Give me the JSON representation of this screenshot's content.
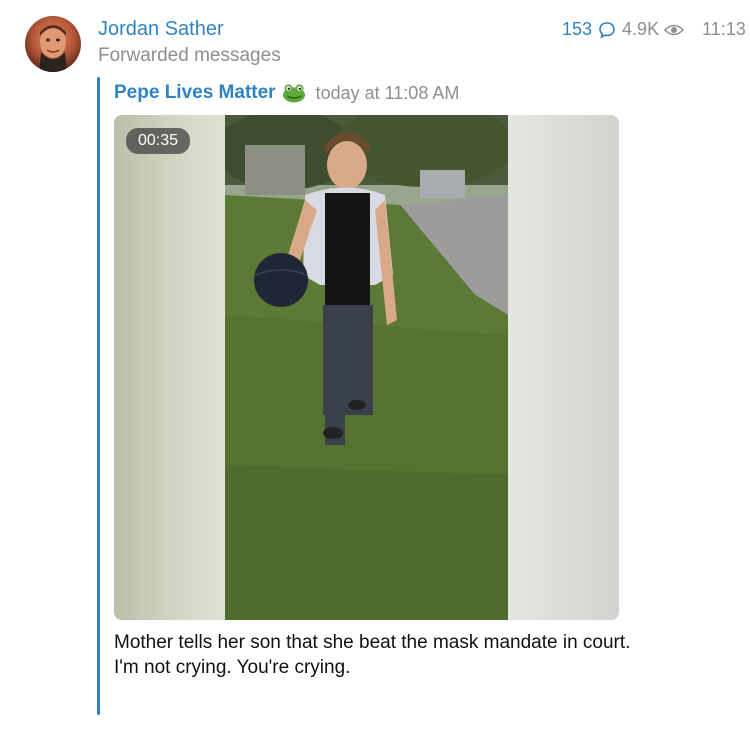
{
  "message": {
    "sender_name": "Jordan Sather",
    "forwarded_label": "Forwarded messages",
    "reply_count": "153",
    "views": "4.9K",
    "time": "11:13",
    "comment_icon": "speech-bubble-icon",
    "views_icon": "eye-icon"
  },
  "forward": {
    "from_name": "Pepe Lives Matter",
    "from_emoji": "frog-icon",
    "timestamp": "today at 11:08 AM",
    "accent_color": "#2f83c4"
  },
  "video": {
    "duration": "00:35"
  },
  "caption": {
    "line1": "Mother tells her son that she beat the mask mandate in court.",
    "line2": "I'm not crying. You're crying."
  }
}
